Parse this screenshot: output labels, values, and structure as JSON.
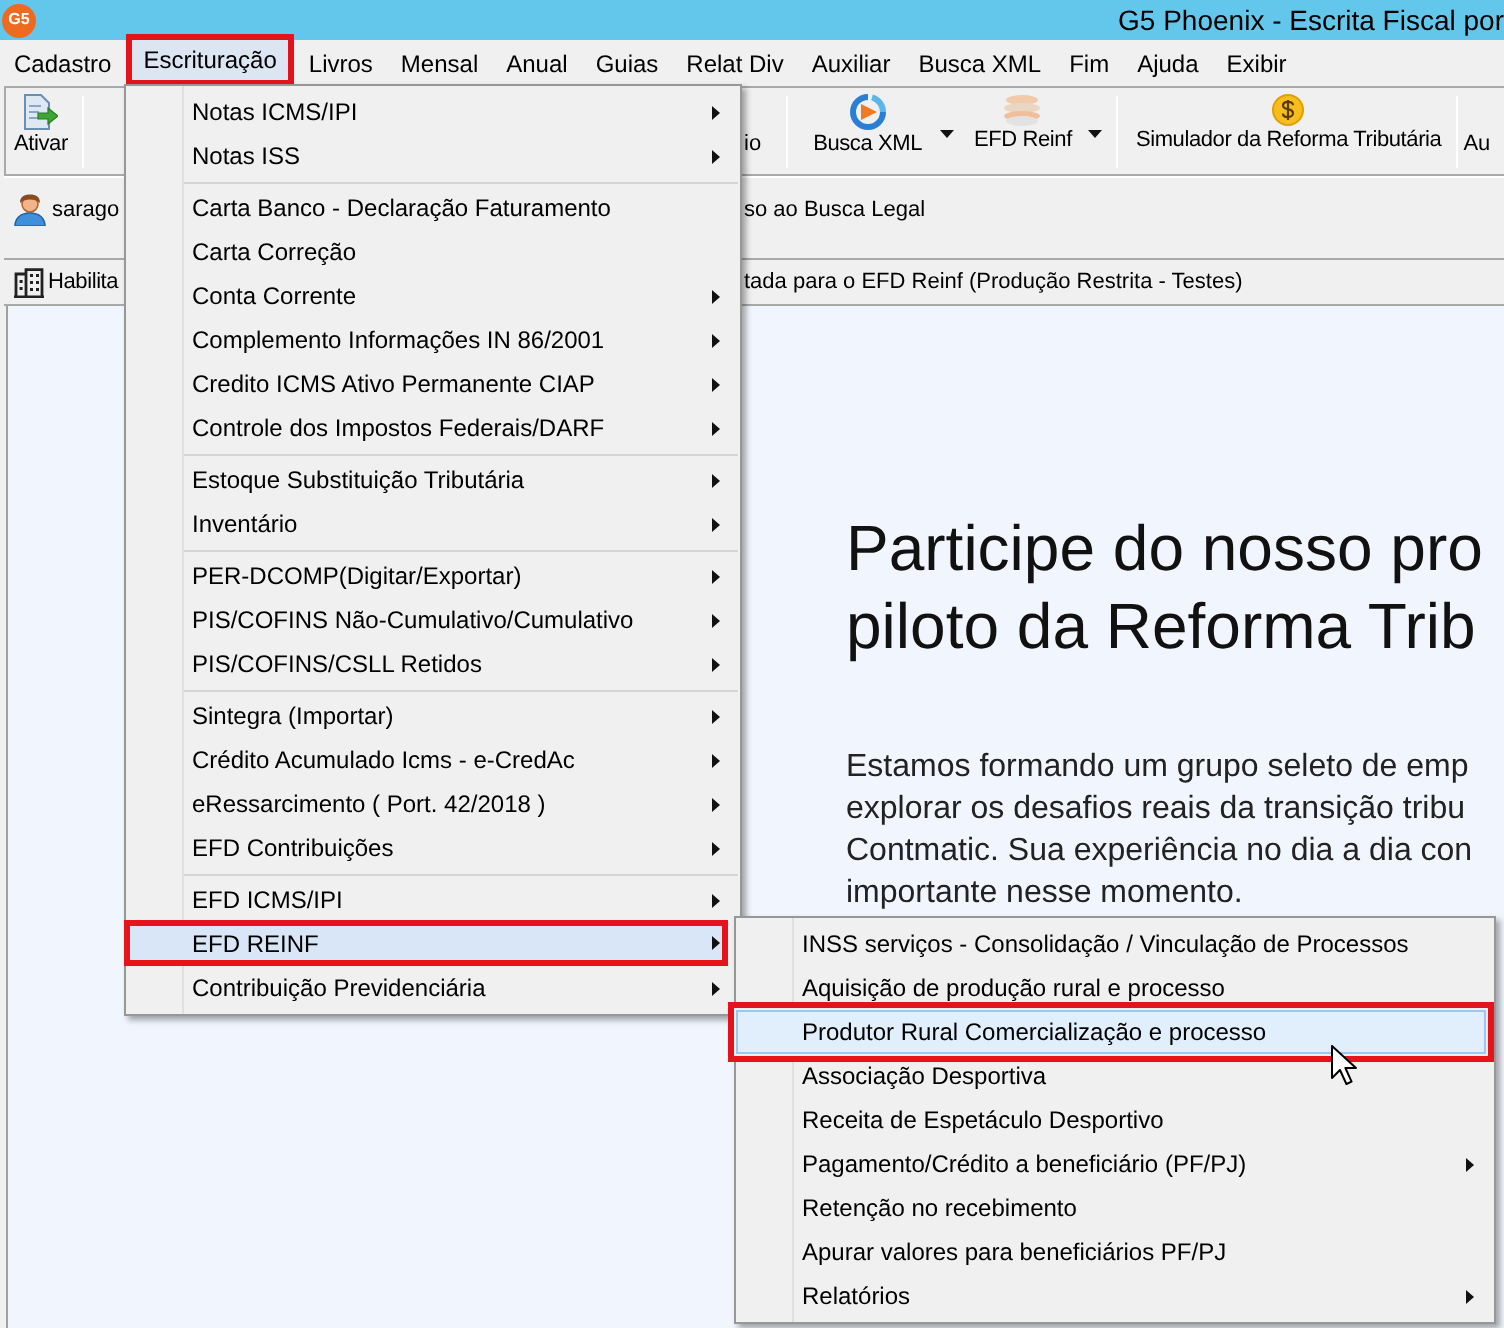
{
  "window": {
    "logo_text": "G5",
    "title": "G5 Phoenix - Escrita Fiscal por"
  },
  "menu_bar": [
    {
      "label": "Cadastro",
      "selected": false
    },
    {
      "label": "Escrituração",
      "selected": true
    },
    {
      "label": "Livros",
      "selected": false
    },
    {
      "label": "Mensal",
      "selected": false
    },
    {
      "label": "Anual",
      "selected": false
    },
    {
      "label": "Guias",
      "selected": false
    },
    {
      "label": "Relat Div",
      "selected": false
    },
    {
      "label": "Auxiliar",
      "selected": false
    },
    {
      "label": "Busca XML",
      "selected": false
    },
    {
      "label": "Fim",
      "selected": false
    },
    {
      "label": "Ajuda",
      "selected": false
    },
    {
      "label": "Exibir",
      "selected": false
    }
  ],
  "toolbar": {
    "groups": [
      [
        {
          "kind": "button",
          "label": "Ativar"
        }
      ],
      [
        {
          "kind": "partial",
          "label": "io"
        }
      ],
      [
        {
          "kind": "split",
          "label": "Busca XML"
        },
        {
          "kind": "split",
          "label": "EFD Reinf"
        }
      ],
      [
        {
          "kind": "button",
          "label": "Simulador da Reforma Tributária"
        }
      ],
      [
        {
          "kind": "partial",
          "label": "Au"
        }
      ]
    ]
  },
  "user_bar": {
    "user_name": "sarago",
    "notice": "so ao Busca Legal"
  },
  "info_bar": {
    "label": "Habilita",
    "notice": "tada para o EFD Reinf (Produção Restrita - Testes)"
  },
  "banner": {
    "heading_lines": [
      "Participe do nosso pro",
      "piloto da Reforma Trib"
    ],
    "paragraph_lines": [
      "Estamos formando um grupo seleto de emp",
      "explorar os desafios reais da transição tribu",
      "Contmatic. Sua experiência no dia a dia con",
      "importante nesse momento."
    ]
  },
  "dropdown_menu": {
    "groups": [
      [
        {
          "label": "Notas ICMS/IPI",
          "has_submenu": true,
          "selected": false
        },
        {
          "label": "Notas ISS",
          "has_submenu": true,
          "selected": false
        }
      ],
      [
        {
          "label": "Carta Banco - Declaração Faturamento",
          "has_submenu": false,
          "selected": false
        },
        {
          "label": "Carta Correção",
          "has_submenu": false,
          "selected": false
        },
        {
          "label": "Conta Corrente",
          "has_submenu": true,
          "selected": false
        },
        {
          "label": "Complemento Informações IN 86/2001",
          "has_submenu": true,
          "selected": false
        },
        {
          "label": "Credito ICMS Ativo Permanente CIAP",
          "has_submenu": true,
          "selected": false
        },
        {
          "label": "Controle dos Impostos Federais/DARF",
          "has_submenu": true,
          "selected": false
        }
      ],
      [
        {
          "label": "Estoque Substituição Tributária",
          "has_submenu": true,
          "selected": false
        },
        {
          "label": "Inventário",
          "has_submenu": true,
          "selected": false
        }
      ],
      [
        {
          "label": "PER-DCOMP(Digitar/Exportar)",
          "has_submenu": true,
          "selected": false
        },
        {
          "label": "PIS/COFINS Não-Cumulativo/Cumulativo",
          "has_submenu": true,
          "selected": false
        },
        {
          "label": "PIS/COFINS/CSLL Retidos",
          "has_submenu": true,
          "selected": false
        }
      ],
      [
        {
          "label": "Sintegra (Importar)",
          "has_submenu": true,
          "selected": false
        },
        {
          "label": "Crédito Acumulado Icms - e-CredAc",
          "has_submenu": true,
          "selected": false
        },
        {
          "label": "eRessarcimento ( Port. 42/2018 )",
          "has_submenu": true,
          "selected": false
        },
        {
          "label": "EFD Contribuições",
          "has_submenu": true,
          "selected": false
        }
      ],
      [
        {
          "label": "EFD ICMS/IPI",
          "has_submenu": true,
          "selected": false
        },
        {
          "label": "EFD REINF",
          "has_submenu": true,
          "selected": true
        },
        {
          "label": "Contribuição Previdenciária",
          "has_submenu": true,
          "selected": false
        }
      ]
    ]
  },
  "submenu": {
    "items": [
      {
        "label": "INSS serviços - Consolidação / Vinculação de Processos",
        "has_submenu": false,
        "selected": false
      },
      {
        "label": "Aquisição de produção rural e processo",
        "has_submenu": false,
        "selected": false
      },
      {
        "label": "Produtor Rural Comercialização e processo",
        "has_submenu": false,
        "selected": true
      },
      {
        "label": "Associação Desportiva",
        "has_submenu": false,
        "selected": false
      },
      {
        "label": "Receita de Espetáculo Desportivo",
        "has_submenu": false,
        "selected": false
      },
      {
        "label": "Pagamento/Crédito a beneficiário (PF/PJ)",
        "has_submenu": true,
        "selected": false
      },
      {
        "label": "Retenção no recebimento",
        "has_submenu": false,
        "selected": false
      },
      {
        "label": "Apurar valores para beneficiários PF/PJ",
        "has_submenu": false,
        "selected": false
      },
      {
        "label": "Relatórios",
        "has_submenu": true,
        "selected": false
      }
    ]
  }
}
